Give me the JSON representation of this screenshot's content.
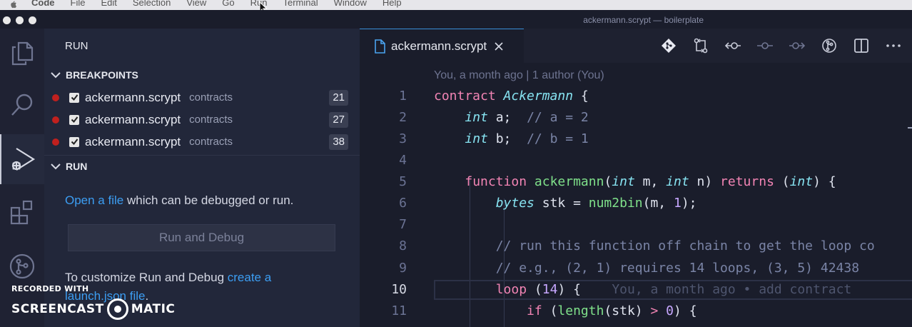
{
  "menubar": {
    "app": "Code",
    "items": [
      "File",
      "Edit",
      "Selection",
      "View",
      "Go",
      "Run",
      "Terminal",
      "Window",
      "Help"
    ]
  },
  "window": {
    "title": "ackermann.scrypt — boilerplate"
  },
  "sidebar": {
    "title": "RUN",
    "breakpoints_header": "BREAKPOINTS",
    "breakpoints": [
      {
        "file": "ackermann.scrypt",
        "folder": "contracts",
        "line": "21"
      },
      {
        "file": "ackermann.scrypt",
        "folder": "contracts",
        "line": "27"
      },
      {
        "file": "ackermann.scrypt",
        "folder": "contracts",
        "line": "38"
      }
    ],
    "run_header": "RUN",
    "open_link": "Open a file",
    "open_rest": " which can be debugged or run.",
    "run_button": "Run and Debug",
    "customize_prefix": "To customize Run and Debug ",
    "customize_link": "create a launch.json file",
    "customize_suffix": "."
  },
  "watermark": {
    "line1": "RECORDED WITH",
    "left": "SCREENCAST",
    "right": "MATIC"
  },
  "editor": {
    "tab": "ackermann.scrypt",
    "codelens": "You, a month ago | 1 author (You)",
    "line_numbers": [
      "1",
      "2",
      "3",
      "4",
      "5",
      "6",
      "7",
      "8",
      "9",
      "10",
      "11"
    ],
    "ghost_text": "You, a month ago • add contract",
    "code": {
      "l1_kw": "contract",
      "l1_cls": "Ackermann",
      "l1_rest": " {",
      "l2_ty": "int",
      "l2_rest": " a;  ",
      "l2_cm": "// a = 2",
      "l3_ty": "int",
      "l3_rest": " b;  ",
      "l3_cm": "// b = 1",
      "l5_kw": "function",
      "l5_fn": "ackermann",
      "l5_p1": "(",
      "l5_ty1": "int",
      "l5_p2": " m, ",
      "l5_ty2": "int",
      "l5_p3": " n) ",
      "l5_kw2": "returns",
      "l5_p4": " (",
      "l5_ty3": "int",
      "l5_p5": ") {",
      "l6_ty": "bytes",
      "l6_rest": " stk = ",
      "l6_fn": "num2bin",
      "l6_a": "(m, ",
      "l6_num": "1",
      "l6_b": ");",
      "l8_cm": "// run this function off chain to get the loop co",
      "l9_cm": "// e.g., (2, 1) requires 14 loops, (3, 5) 42438",
      "l10_kw": "loop",
      "l10_a": " (",
      "l10_num": "14",
      "l10_b": ") {",
      "l11_kw": "if",
      "l11_a": " (",
      "l11_fn": "length",
      "l11_b": "(stk) ",
      "l11_op": ">",
      "l11_c": " ",
      "l11_num": "0",
      "l11_d": ") {"
    }
  }
}
